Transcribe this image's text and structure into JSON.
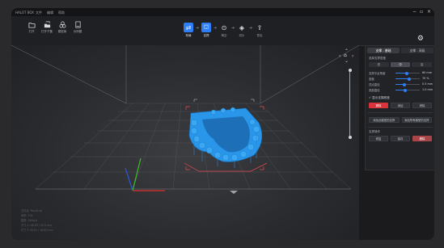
{
  "app": {
    "title": "HALOT BOX",
    "menu": [
      "文件",
      "编辑",
      "帮助"
    ],
    "window_controls": [
      "−",
      "▫",
      "×"
    ]
  },
  "toolbar": {
    "file_buttons": [
      {
        "label": "打开",
        "icon": "folder-icon"
      },
      {
        "label": "打开子集",
        "icon": "open-set-icon"
      },
      {
        "label": "模型库",
        "icon": "model-library-icon"
      },
      {
        "label": "示例模",
        "icon": "sample-model-icon"
      }
    ],
    "steps": [
      {
        "label": "布局",
        "icon": "layout-icon",
        "active": true
      },
      {
        "label": "支撑",
        "icon": "support-icon",
        "active": true
      },
      {
        "label": "掏空",
        "icon": "hollow-icon",
        "active": false
      },
      {
        "label": "切片",
        "icon": "slice-icon",
        "active": false
      },
      {
        "label": "导出",
        "icon": "export-icon",
        "active": false
      }
    ],
    "settings_icon": "gear-icon"
  },
  "panel": {
    "tabs": [
      "支撑 - 基础",
      "支撑 - 高级"
    ],
    "section_label": "选择支撑密度",
    "density_options": [
      "低",
      "中",
      "高"
    ],
    "density_selected": "中",
    "sliders": [
      {
        "name": "支撑平台角度",
        "value": "60",
        "unit": "mm",
        "level": 0.45
      },
      {
        "name": "密度",
        "value": "70",
        "unit": "%",
        "level": 0.55
      },
      {
        "name": "顶点直径",
        "value": "0.5",
        "unit": "mm",
        "level": 0.35
      },
      {
        "name": "底部直径",
        "value": "1.0",
        "unit": "mm",
        "level": 0.4
      }
    ],
    "auto_support_checkbox": "显示支撑底座",
    "action_buttons": [
      "删除",
      "添加",
      "清除"
    ],
    "wide_buttons": [
      "添加此模型的支撑",
      "添加所有模型的支撑"
    ],
    "section2_label": "支撑操作",
    "bottom_buttons": [
      "修复",
      "保存",
      "删除"
    ]
  },
  "viewport": {
    "info_lines": [
      "文件名: Mould.stl",
      "体积: 194",
      "模型: Default",
      "尺寸 X: 48.83 / 43.9 mm",
      "尺寸 Y: 49.81 / 18.80 mm"
    ]
  },
  "colors": {
    "accent": "#2d7ff9",
    "model": "#1e8fe6",
    "danger": "#d9343b"
  }
}
